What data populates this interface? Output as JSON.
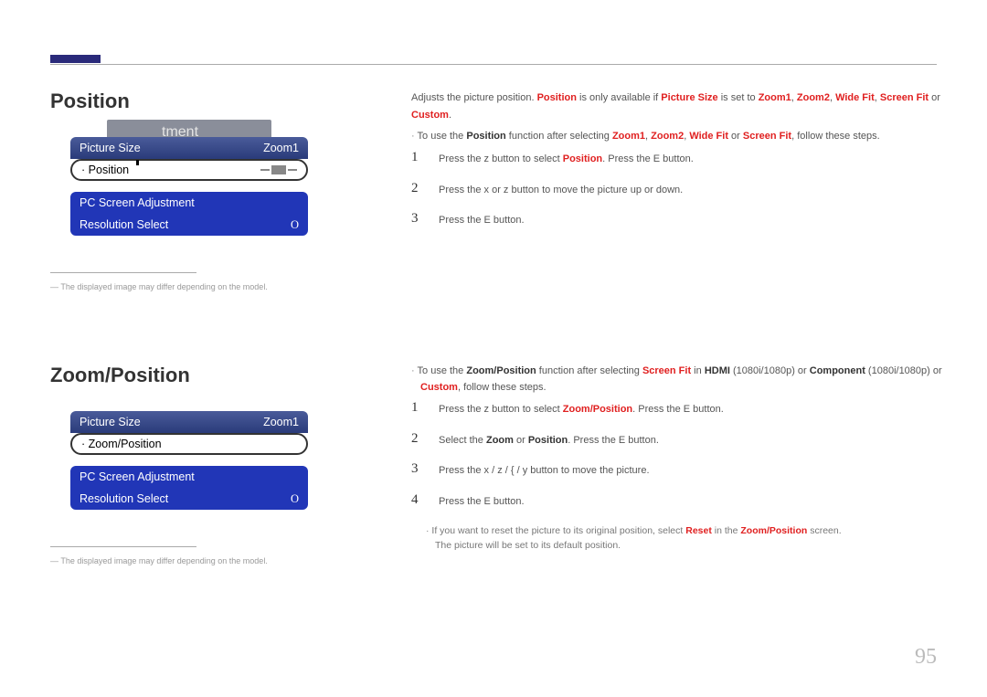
{
  "page_number": "95",
  "section1": {
    "heading": "Position",
    "menu": {
      "overflow_text": "tment",
      "row1_label": "Picture Size",
      "row1_value": "Zoom1",
      "row2_label": "Position",
      "row2_prefix": "·",
      "row3_label": "PC Screen Adjustment",
      "row4_label": "Resolution Select",
      "row4_value": "O"
    },
    "disclaimer": "―  The displayed image may differ depending on the model.",
    "intro": {
      "t1": "Adjusts the picture position. ",
      "t2": "Position",
      "t3": " is only available if ",
      "t4": "Picture Size",
      "t5": " is set to ",
      "t6": "Zoom1",
      "t7": ", ",
      "t8": "Zoom2",
      "t9": ", ",
      "t10": "Wide Fit",
      "t11": ", ",
      "t12": "Screen Fit",
      "t13": " or ",
      "t14": "Custom",
      "t15": "."
    },
    "bullet": {
      "b1": "To use the ",
      "b2": "Position",
      "b3": " function after selecting ",
      "b4": "Zoom1",
      "b5": ", ",
      "b6": "Zoom2",
      "b7": ", ",
      "b8": "Wide Fit",
      "b9": " or ",
      "b10": "Screen Fit",
      "b11": ", follow these steps."
    },
    "steps": [
      {
        "num": "1",
        "a": "Press the  z  button to select ",
        "b": "Position",
        "c": ". Press the E button."
      },
      {
        "num": "2",
        "a": "Press the  x  or  z  button to move the picture up or down.",
        "b": "",
        "c": ""
      },
      {
        "num": "3",
        "a": "Press the E button.",
        "b": "",
        "c": ""
      }
    ]
  },
  "section2": {
    "heading": "Zoom/Position",
    "menu": {
      "row1_label": "Picture Size",
      "row1_value": "Zoom1",
      "row2_label": "Zoom/Position",
      "row2_prefix": "·",
      "row3_label": "PC Screen Adjustment",
      "row4_label": "Resolution Select",
      "row4_value": "O"
    },
    "disclaimer": "―  The displayed image may differ depending on the model.",
    "bullet": {
      "b1": "To use the ",
      "b2": "Zoom/Position",
      "b3": " function after selecting ",
      "b4": "Screen Fit",
      "b5": " in ",
      "b6": "HDMI",
      "b7": " (1080i/1080p) or ",
      "b8": "Component",
      "b9": " (1080i/1080p) or ",
      "b10": "Custom",
      "b11": ", follow these steps."
    },
    "steps": [
      {
        "num": "1",
        "a": "Press the  z  button to select ",
        "b": "Zoom/Position",
        "c": ". Press the E button."
      },
      {
        "num": "2",
        "a": "Select the ",
        "b": "Zoom",
        "c": " or ",
        "d": "Position",
        "e": ". Press the E button."
      },
      {
        "num": "3",
        "a": "Press the  x / z / { / y  button to move the picture.",
        "b": "",
        "c": ""
      },
      {
        "num": "4",
        "a": "Press the E button.",
        "b": "",
        "c": ""
      }
    ],
    "sub": {
      "s1": "If you want to reset the picture to its original position, select ",
      "s2": "Reset",
      "s3": " in the ",
      "s4": "Zoom/Position",
      "s5": " screen.",
      "s6": "The picture will be set to its default position."
    }
  }
}
